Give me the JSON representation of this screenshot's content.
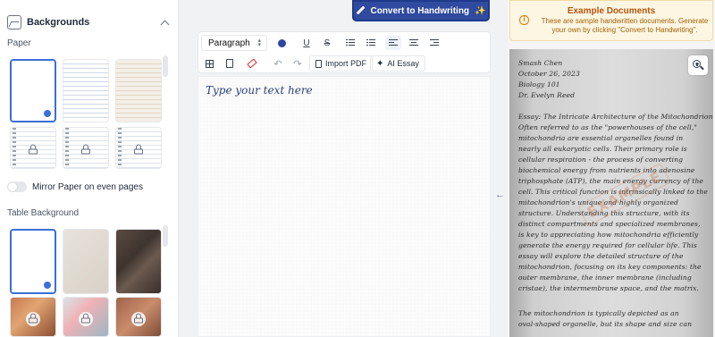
{
  "left_panel": {
    "title": "Backgrounds",
    "paper_label": "Paper",
    "mirror_label": "Mirror Paper on even pages",
    "mirror_enabled": false,
    "table_bg_label": "Table Background"
  },
  "header": {
    "convert_label": "Convert to Handwriting",
    "sparkle": "✨"
  },
  "toolbar": {
    "paragraph_label": "Paragraph",
    "text_color": "#2f45a6",
    "underline": "U",
    "strike": "S",
    "import_pdf": "Import PDF",
    "ai_essay": "AI Essay"
  },
  "editor": {
    "placeholder": "Type your text here"
  },
  "examples": {
    "title": "Example Documents",
    "text": "These are sample handwritten documents. Generate your own by clicking \"Convert to Handwriting\".",
    "stamp": "EXAMPLE",
    "heading_lines": [
      "Smash Chen",
      "October 26, 2023",
      "Biology 101",
      "Dr. Evelyn Reed"
    ],
    "body_lines": [
      "Essay: The Intricate Architecture of the Mitochondrion",
      "Often referred to as the \"powerhouses of the cell,\"",
      "mitochondria are essential organelles found in",
      "nearly all eukaryotic cells. Their primary role is",
      "cellular respiration - the process of converting",
      "biochemical energy from nutrients into adenosine",
      "triphosphate (ATP), the main energy currency of the",
      "cell. This critical function is intrinsically linked to the",
      "mitochondrion's unique and highly organized",
      "structure. Understanding this structure, with its",
      "distinct compartments and specialized membranes,",
      "is key to appreciating how mitochondria efficiently",
      "generate the energy required for cellular life. This",
      "essay will explore the detailed structure of the",
      "mitochondrion, focusing on its key components: the",
      "outer membrane, the inner membrane (including",
      "cristae), the intermembrane space, and the matrix."
    ],
    "tail_lines": [
      "The mitochondrion is typically depicted as an",
      "oval-shaped organelle, but its shape and size can"
    ]
  },
  "colors": {
    "accent": "#2f4a9e",
    "selected": "#3b6fd8",
    "warning_bg": "#fdf6e3",
    "warning_text": "#b45309"
  }
}
